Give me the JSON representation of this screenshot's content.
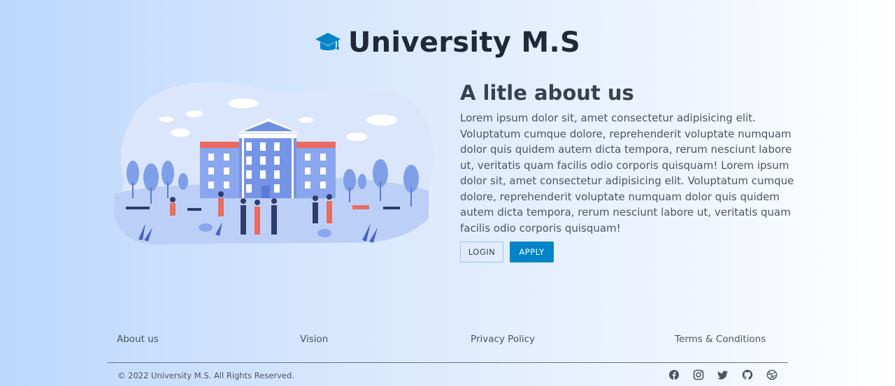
{
  "brand": {
    "title": "University M.S",
    "icon": "graduation-cap-icon",
    "icon_color": "#0284c7"
  },
  "hero": {
    "illustration": "university-campus-illustration"
  },
  "about": {
    "heading": "A litle about us",
    "text": "Lorem ipsum dolor sit, amet consectetur adipisicing elit. Voluptatum cumque dolore, reprehenderit voluptate numquam dolor quis quidem autem dicta tempora, rerum nesciunt labore ut, veritatis quam facilis odio corporis quisquam! Lorem ipsum dolor sit, amet consectetur adipisicing elit. Voluptatum cumque dolore, reprehenderit voluptate numquam dolor quis quidem autem dicta tempora, rerum nesciunt labore ut, veritatis quam facilis odio corporis quisquam!",
    "login_label": "LOGIN",
    "apply_label": "APPLY",
    "accent_color": "#0284c7"
  },
  "footer": {
    "links": [
      "About us",
      "Vision",
      "Privacy Policy",
      "Terms & Conditions"
    ],
    "copyright": "© 2022 University M.S. All Rights Reserved.",
    "socials": [
      "facebook-icon",
      "instagram-icon",
      "twitter-icon",
      "github-icon",
      "dribbble-icon"
    ]
  }
}
